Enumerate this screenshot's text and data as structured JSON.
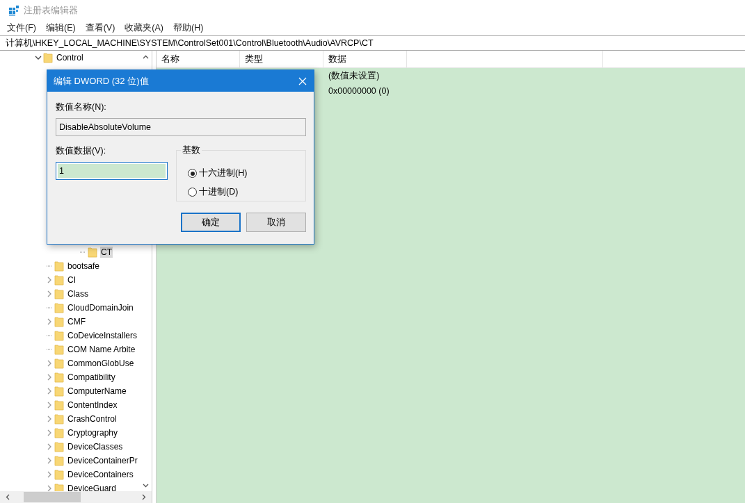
{
  "window": {
    "title": "注册表编辑器"
  },
  "menu": [
    "文件(F)",
    "编辑(E)",
    "查看(V)",
    "收藏夹(A)",
    "帮助(H)"
  ],
  "address": "计算机\\HKEY_LOCAL_MACHINE\\SYSTEM\\ControlSet001\\Control\\Bluetooth\\Audio\\AVRCP\\CT",
  "tree": {
    "label": "Control",
    "expanded": true,
    "children": [
      {
        "label": "CT",
        "kind": "nested",
        "expandable": false,
        "selected": true
      },
      {
        "label": "bootsafe",
        "kind": "key",
        "expandable": false,
        "selected": false
      },
      {
        "label": "CI",
        "kind": "key",
        "expandable": true,
        "selected": false
      },
      {
        "label": "Class",
        "kind": "key",
        "expandable": true,
        "selected": false
      },
      {
        "label": "CloudDomainJoin",
        "kind": "key",
        "expandable": false,
        "selected": false
      },
      {
        "label": "CMF",
        "kind": "key",
        "expandable": true,
        "selected": false
      },
      {
        "label": "CoDeviceInstallers",
        "kind": "key",
        "expandable": false,
        "selected": false
      },
      {
        "label": "COM Name Arbite",
        "kind": "key",
        "expandable": false,
        "selected": false
      },
      {
        "label": "CommonGlobUse",
        "kind": "key",
        "expandable": true,
        "selected": false
      },
      {
        "label": "Compatibility",
        "kind": "key",
        "expandable": true,
        "selected": false
      },
      {
        "label": "ComputerName",
        "kind": "key",
        "expandable": true,
        "selected": false
      },
      {
        "label": "ContentIndex",
        "kind": "key",
        "expandable": true,
        "selected": false
      },
      {
        "label": "CrashControl",
        "kind": "key",
        "expandable": true,
        "selected": false
      },
      {
        "label": "Cryptography",
        "kind": "key",
        "expandable": true,
        "selected": false
      },
      {
        "label": "DeviceClasses",
        "kind": "key",
        "expandable": true,
        "selected": false
      },
      {
        "label": "DeviceContainerPr",
        "kind": "key",
        "expandable": true,
        "selected": false
      },
      {
        "label": "DeviceContainers",
        "kind": "key",
        "expandable": true,
        "selected": false
      },
      {
        "label": "DeviceGuard",
        "kind": "key",
        "expandable": true,
        "selected": false
      }
    ]
  },
  "table": {
    "columns": [
      "名称",
      "类型",
      "数据"
    ],
    "rows": [
      {
        "data": "(数值未设置)"
      },
      {
        "data": "0x00000000 (0)"
      }
    ]
  },
  "dialog": {
    "title": "编辑 DWORD (32 位)值",
    "name_label": "数值名称(N):",
    "name_value": "DisableAbsoluteVolume",
    "data_label": "数值数据(V):",
    "data_value": "1",
    "base_label": "基数",
    "radios": [
      {
        "label": "十六进制(H)",
        "selected": true
      },
      {
        "label": "十进制(D)",
        "selected": false
      }
    ],
    "buttons": [
      "确定",
      "取消"
    ]
  }
}
